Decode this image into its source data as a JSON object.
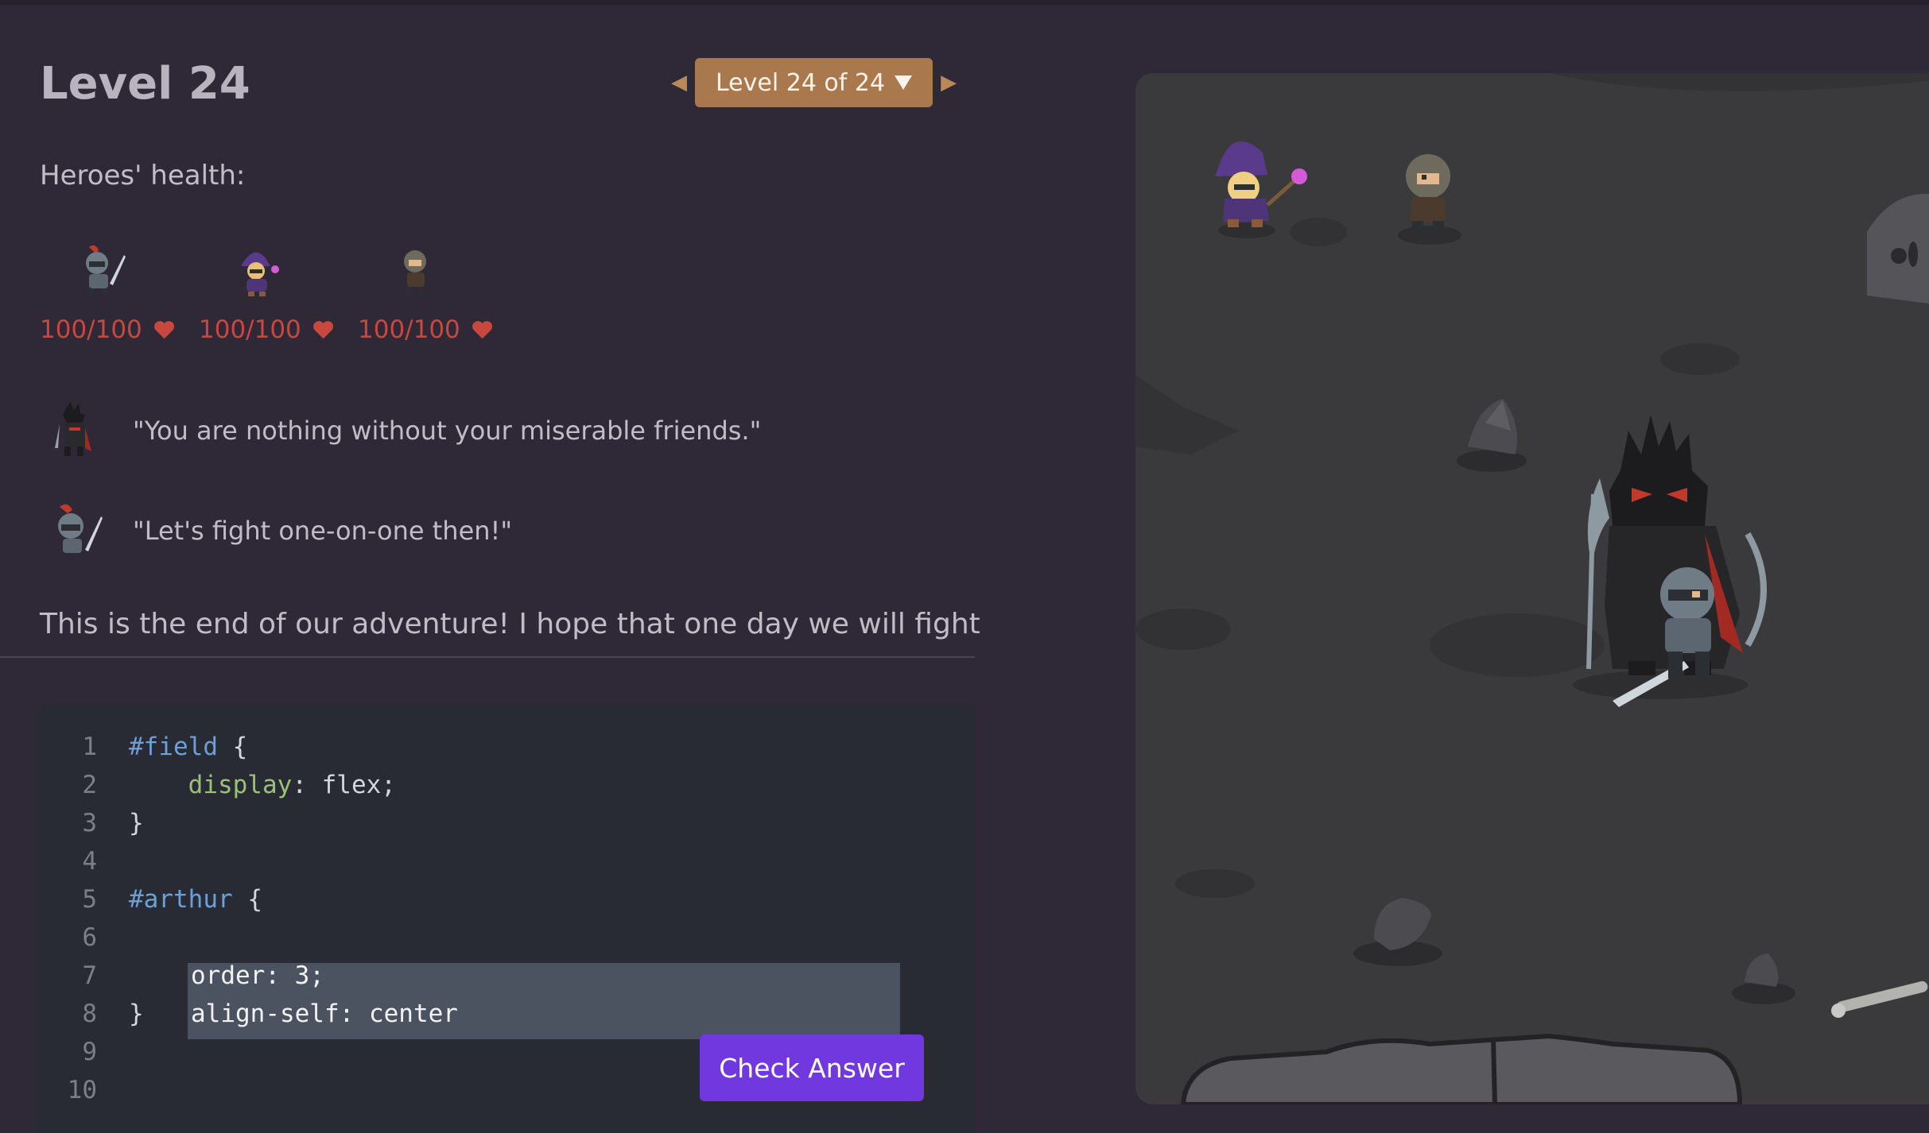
{
  "level": {
    "title": "Level 24",
    "selector_label": "Level 24 of 24",
    "prev_arrow": "◀",
    "next_arrow": "▶"
  },
  "health": {
    "label": "Heroes' health:",
    "heroes": [
      {
        "name": "knight",
        "hp": "100/100",
        "icon": "knight-sprite"
      },
      {
        "name": "wizard",
        "hp": "100/100",
        "icon": "wizard-sprite"
      },
      {
        "name": "rogue",
        "hp": "100/100",
        "icon": "rogue-sprite"
      }
    ]
  },
  "dialog": [
    {
      "speaker": "dark-knight",
      "text": "\"You are nothing without your miserable friends.\""
    },
    {
      "speaker": "knight",
      "text": "\"Let's fight one-on-one then!\""
    }
  ],
  "story": "This is the end of our adventure! I hope that one day we will fight",
  "editor": {
    "line_numbers": [
      "1",
      "2",
      "3",
      "4",
      "5",
      "6",
      "7",
      "8",
      "9",
      "10"
    ],
    "lines": [
      {
        "sel": "#field",
        "rest": " {"
      },
      {
        "prop": "    display",
        "rest": ": flex;"
      },
      {
        "rest": "}"
      },
      {
        "rest": ""
      },
      {
        "sel": "#arthur",
        "rest": " {"
      },
      {
        "rest": ""
      },
      {
        "rest": ""
      },
      {
        "rest": "}"
      }
    ],
    "input_lines": [
      "order: 3;",
      "align-self: center"
    ]
  },
  "check_button": "Check Answer",
  "colors": {
    "accent": "#7138df",
    "level_button": "#a9794d",
    "health": "#c8483f",
    "background": "#2e2837"
  }
}
